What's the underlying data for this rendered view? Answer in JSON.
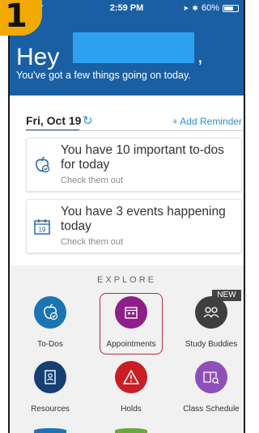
{
  "badge": {
    "number": "1"
  },
  "status_bar": {
    "time": "2:59 PM",
    "battery": "60%"
  },
  "header": {
    "greeting": "Hey",
    "subtitle": "You've got a few things going on today."
  },
  "date_bar": {
    "date": "Fri, Oct 19",
    "refresh_icon": "refresh-icon",
    "add_reminder": "+ Add Reminder"
  },
  "cards": [
    {
      "title": "You have 10 important to-dos for today",
      "link": "Check them out",
      "icon": "apple-check-icon"
    },
    {
      "title": "You have 3 events happening today",
      "link": "Check them out",
      "icon": "calendar-19-icon",
      "calendar_day": "19"
    }
  ],
  "explore": {
    "title": "EXPLORE",
    "new_tag": "NEW",
    "tiles": [
      {
        "label": "To-Dos",
        "icon": "apple-check-icon",
        "color": "#1b74b3"
      },
      {
        "label": "Appointments",
        "icon": "calendar-icon",
        "color": "#8e1e8a"
      },
      {
        "label": "Study Buddies",
        "icon": "people-icon",
        "color": "#3f3f3f"
      },
      {
        "label": "Resources",
        "icon": "book-icon",
        "color": "#163f73"
      },
      {
        "label": "Holds",
        "icon": "warning-icon",
        "color": "#c81e24"
      },
      {
        "label": "Class Schedule",
        "icon": "book-search-icon",
        "color": "#8e4fb8"
      }
    ]
  },
  "colors": {
    "header_blue": "#1a5fa3",
    "accent_blue": "#2d8fd6",
    "badge_orange": "#f2a900"
  }
}
